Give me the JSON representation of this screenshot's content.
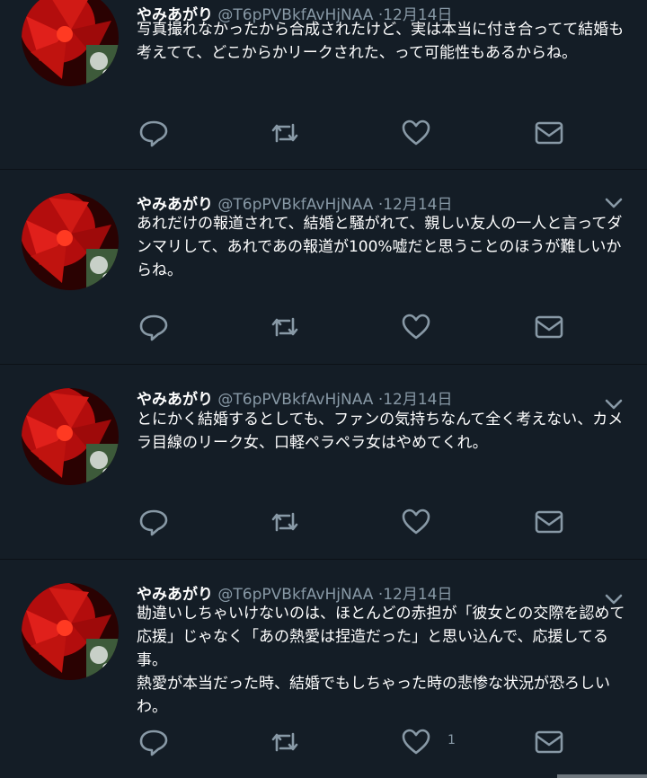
{
  "tweets": [
    {
      "name": "やみあがり",
      "handle": "@T6pPVBkfAvHjNAA",
      "separator": "·",
      "date": "12月14日",
      "text": "写真撮れなかったから合成されたけど、実は本当に付き合ってて結婚も考えてて、どこからかリークされた、って可能性もあるからね。"
    },
    {
      "name": "やみあがり",
      "handle": "@T6pPVBkfAvHjNAA",
      "separator": "·",
      "date": "12月14日",
      "text": "あれだけの報道されて、結婚と騒がれて、親しい友人の一人と言ってダンマリして、あれであの報道が100%嘘だと思うことのほうが難しいからね。"
    },
    {
      "name": "やみあがり",
      "handle": "@T6pPVBkfAvHjNAA",
      "separator": "·",
      "date": "12月14日",
      "text": "とにかく結婚するとしても、ファンの気持ちなんて全く考えない、カメラ目線のリーク女、口軽ペラペラ女はやめてくれ。"
    },
    {
      "name": "やみあがり",
      "handle": "@T6pPVBkfAvHjNAA",
      "separator": "·",
      "date": "12月14日",
      "text": "勘違いしちゃいけないのは、ほとんどの赤担が「彼女との交際を認めて応援」じゃなく「あの熱愛は捏造だった」と思い込んで、応援してる事。\n熱愛が本当だった時、結婚でもしちゃった時の悲惨な状況が恐ろしいわ。",
      "like_count": "1"
    }
  ],
  "icons": {
    "reply": "reply-icon",
    "retweet": "retweet-icon",
    "like": "heart-icon",
    "dm": "envelope-icon",
    "menu": "chevron-down-icon"
  },
  "colors": {
    "background": "#141d26",
    "text": "#ffffff",
    "secondary": "#8899a6",
    "divider": "#0c1117"
  }
}
